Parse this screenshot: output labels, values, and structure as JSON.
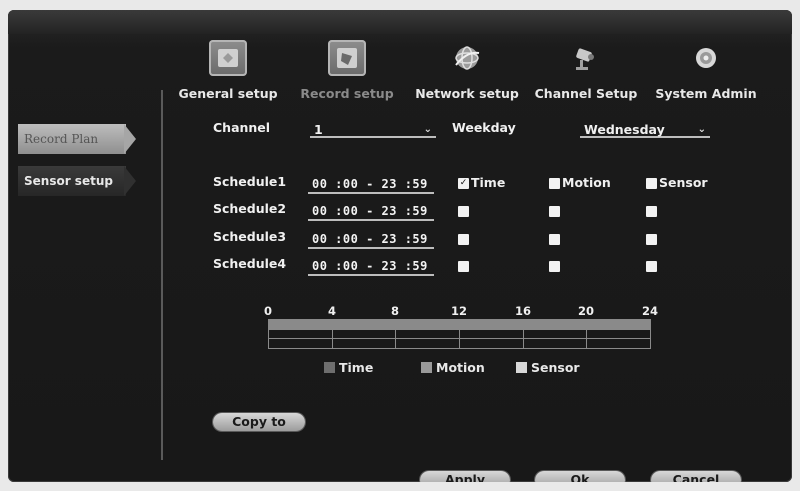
{
  "nav": {
    "items": [
      {
        "label": "General setup",
        "icon": "general-setup-icon"
      },
      {
        "label": "Record setup",
        "icon": "record-setup-icon",
        "active": true
      },
      {
        "label": "Network setup",
        "icon": "network-globe-icon"
      },
      {
        "label": "Channel Setup",
        "icon": "camera-icon"
      },
      {
        "label": "System Admin",
        "icon": "system-disc-icon"
      }
    ]
  },
  "sidebar": {
    "items": [
      {
        "label": "Record Plan",
        "active": true
      },
      {
        "label": "Sensor setup",
        "active": false
      }
    ]
  },
  "form": {
    "channel_label": "Channel",
    "channel_value": "1",
    "weekday_label": "Weekday",
    "weekday_value": "Wednesday"
  },
  "schedules": [
    {
      "label": "Schedule1",
      "time": "00 :00 - 23 :59",
      "time_checked": true,
      "motion_checked": false,
      "sensor_checked": false
    },
    {
      "label": "Schedule2",
      "time": "00 :00 - 23 :59",
      "time_checked": false,
      "motion_checked": false,
      "sensor_checked": false
    },
    {
      "label": "Schedule3",
      "time": "00 :00 - 23 :59",
      "time_checked": false,
      "motion_checked": false,
      "sensor_checked": false
    },
    {
      "label": "Schedule4",
      "time": "00 :00 - 23 :59",
      "time_checked": false,
      "motion_checked": false,
      "sensor_checked": false
    }
  ],
  "checkbox_labels": {
    "time": "Time",
    "motion": "Motion",
    "sensor": "Sensor"
  },
  "timeline": {
    "ticks": [
      "0",
      "4",
      "8",
      "12",
      "16",
      "20",
      "24"
    ]
  },
  "legend": [
    {
      "label": "Time",
      "color": "#6e6e6e"
    },
    {
      "label": "Motion",
      "color": "#9a9a9a"
    },
    {
      "label": "Sensor",
      "color": "#d8d8d8"
    }
  ],
  "buttons": {
    "copy_to": "Copy to",
    "apply": "Apply",
    "ok": "Ok",
    "cancel": "Cancel"
  }
}
